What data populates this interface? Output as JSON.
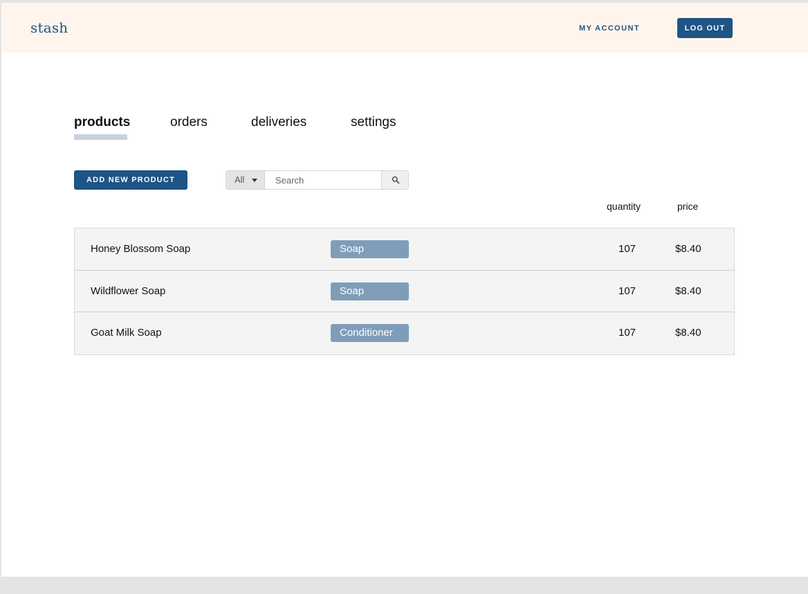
{
  "header": {
    "brand": "stash",
    "my_account_label": "MY ACCOUNT",
    "logout_label": "LOG OUT"
  },
  "tabs": [
    {
      "label": "products",
      "active": true
    },
    {
      "label": "orders",
      "active": false
    },
    {
      "label": "deliveries",
      "active": false
    },
    {
      "label": "settings",
      "active": false
    }
  ],
  "toolbar": {
    "add_label": "ADD NEW PRODUCT",
    "filter_selected": "All",
    "search_placeholder": "Search"
  },
  "table": {
    "columns": {
      "quantity": "quantity",
      "price": "price"
    },
    "rows": [
      {
        "name": "Honey Blossom Soap",
        "category": "Soap",
        "quantity": "107",
        "price": "$8.40"
      },
      {
        "name": "Wildflower Soap",
        "category": "Soap",
        "quantity": "107",
        "price": "$8.40"
      },
      {
        "name": "Goat Milk Soap",
        "category": "Conditioner",
        "quantity": "107",
        "price": "$8.40"
      }
    ]
  },
  "colors": {
    "brand_blue": "#1f5486",
    "header_bg": "#fff5ec",
    "tag_bg": "#7f9db9",
    "tab_underline": "#c6d2df",
    "row_bg": "#f4f4f4"
  },
  "icons": {
    "search": "search-icon",
    "filter_caret": "caret-down-icon"
  }
}
